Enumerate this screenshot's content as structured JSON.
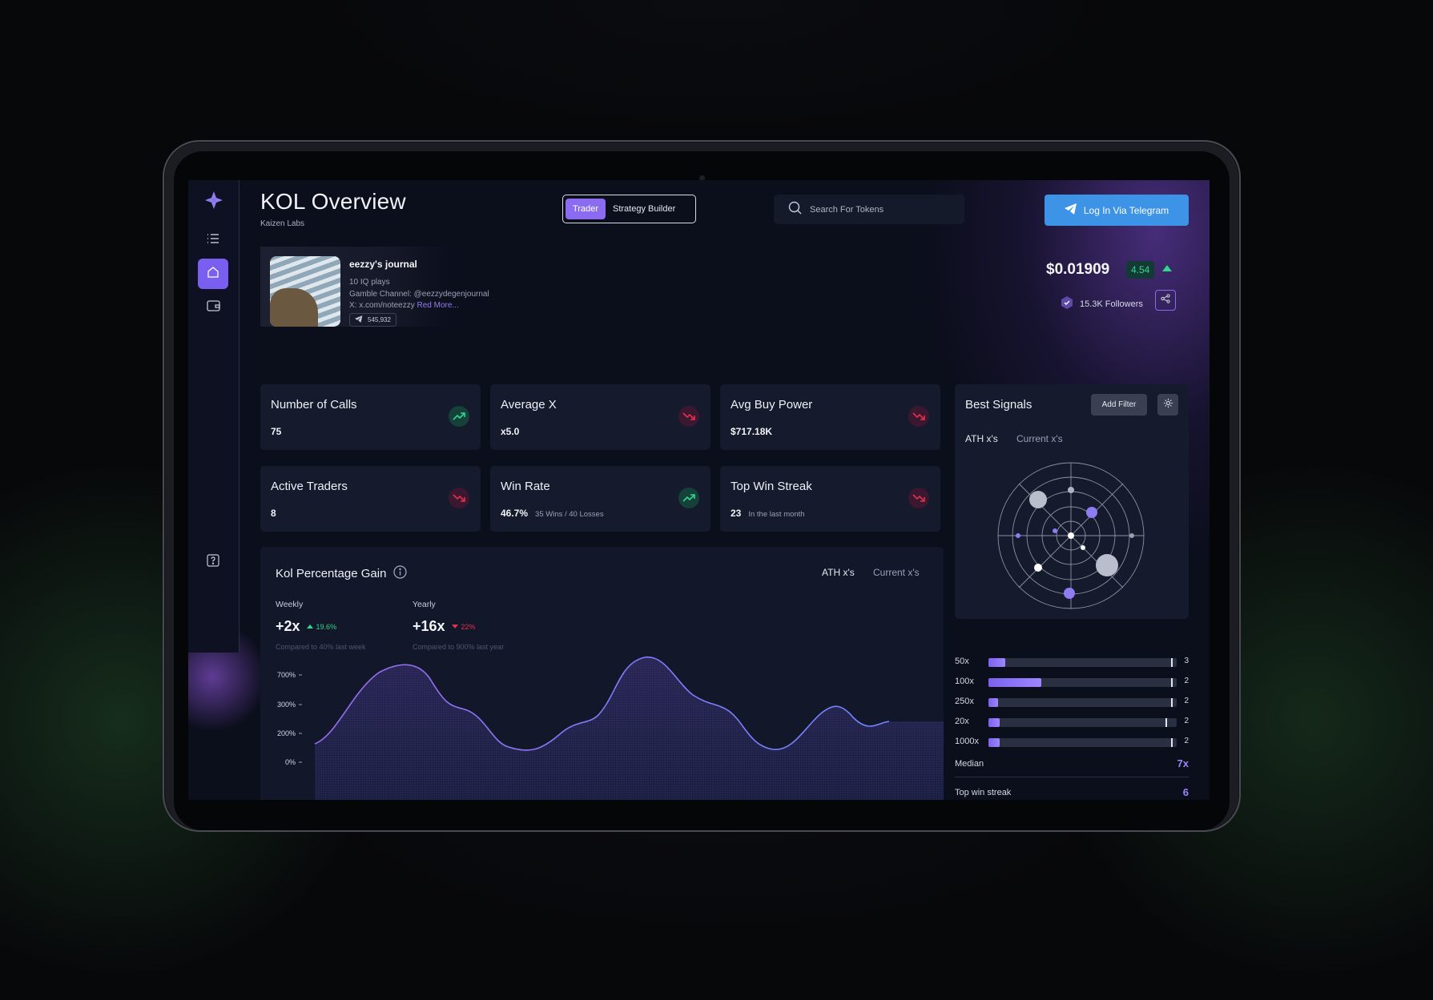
{
  "app": {
    "title": "KOL Overview",
    "subtitle": "Kaizen Labs"
  },
  "colors": {
    "accent": "#8b6cf0",
    "positive": "#2fd88c",
    "negative": "#e2314d",
    "telegram": "#3d93e6"
  },
  "sidebar": {
    "items": [
      {
        "icon": "list-icon"
      },
      {
        "icon": "home-icon",
        "active": true
      },
      {
        "icon": "wallet-icon"
      },
      {
        "icon": "help-icon"
      }
    ]
  },
  "header": {
    "mode_tabs": [
      {
        "label": "Trader",
        "active": true
      },
      {
        "label": "Strategy Builder",
        "active": false
      }
    ],
    "search_placeholder": "Search For Tokens",
    "login_label": "Log In Via Telegram"
  },
  "profile": {
    "name": "eezzy's journal",
    "tagline": "10 IQ plays",
    "channel": "Gamble Channel: @eezzydegenjournal",
    "x_handle": "X: x.com/noteezzy",
    "read_more": "Red More...",
    "telegram_count": "545,932",
    "price": "$0.01909",
    "change": "4.54",
    "followers": "15.3K Followers"
  },
  "stats": [
    {
      "label": "Number of Calls",
      "value": "75",
      "sub": "",
      "trend": "up"
    },
    {
      "label": "Average X",
      "value": "x5.0",
      "sub": "",
      "trend": "down"
    },
    {
      "label": "Avg Buy Power",
      "value": "$717.18K",
      "sub": "",
      "trend": "down"
    },
    {
      "label": "Active Traders",
      "value": "8",
      "sub": "",
      "trend": "down"
    },
    {
      "label": "Win Rate",
      "value": "46.7%",
      "sub": "35 Wins / 40 Losses",
      "trend": "up"
    },
    {
      "label": "Top Win Streak",
      "value": "23",
      "sub": "In the last month",
      "trend": "down"
    }
  ],
  "signals": {
    "title": "Best Signals",
    "add_filter": "Add Filter",
    "tabs": [
      {
        "label": "ATH x's",
        "active": true
      },
      {
        "label": "Current x's",
        "active": false
      }
    ]
  },
  "distribution": [
    {
      "label": "50x",
      "fraction": 0.09,
      "count": "3"
    },
    {
      "label": "100x",
      "fraction": 0.28,
      "count": "2"
    },
    {
      "label": "250x",
      "fraction": 0.05,
      "count": "2"
    },
    {
      "label": "20x",
      "fraction": 0.06,
      "count": "2"
    },
    {
      "label": "1000x",
      "fraction": 0.06,
      "count": "2"
    }
  ],
  "summary": [
    {
      "label": "Median",
      "value": "7x"
    },
    {
      "label": "Top win streak",
      "value": "6"
    }
  ],
  "gain": {
    "title": "Kol Percentage Gain",
    "tabs": [
      {
        "label": "ATH x's",
        "active": true
      },
      {
        "label": "Current x's",
        "active": false
      }
    ],
    "weekly": {
      "label": "Weekly",
      "value": "+2x",
      "change": "19.6%",
      "compare": "Compared to 40% last week"
    },
    "yearly": {
      "label": "Yearly",
      "value": "+16x",
      "change": "22%",
      "compare": "Compared to 900% last year"
    },
    "y_ticks": [
      "700%",
      "300%",
      "200%",
      "0%"
    ]
  }
}
